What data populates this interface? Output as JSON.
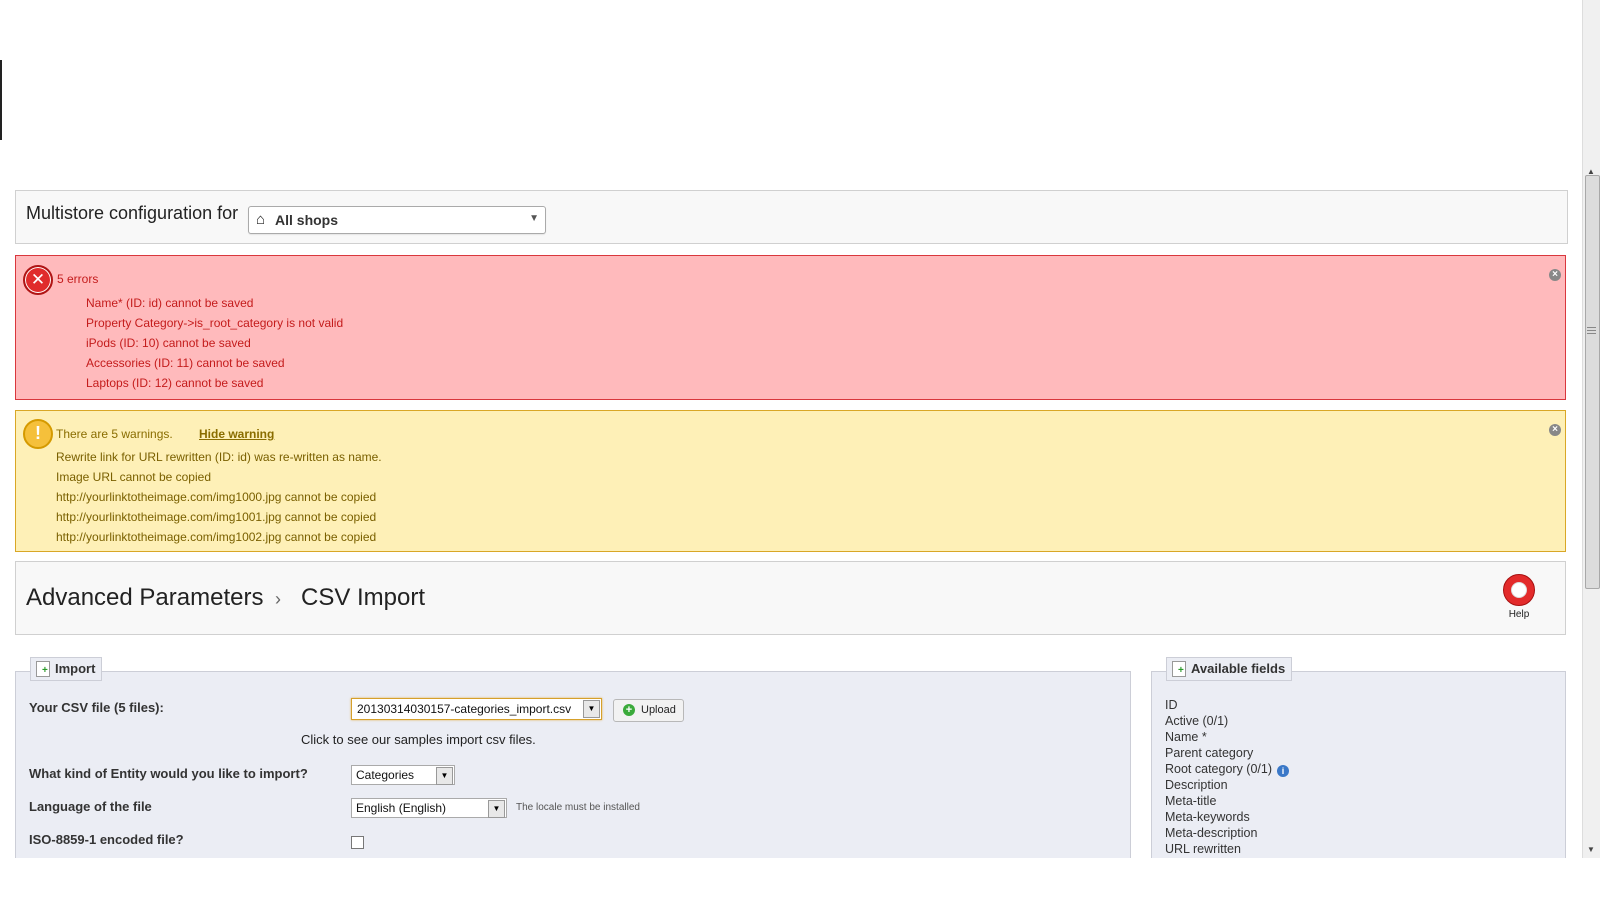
{
  "multistore": {
    "label": "Multistore configuration for",
    "selected_shop": "All shops"
  },
  "errors": {
    "title": "5 errors",
    "items": [
      "Name* (ID: id) cannot be saved",
      "Property Category->is_root_category is not valid",
      "iPods (ID: 10) cannot be saved",
      "Accessories (ID: 11) cannot be saved",
      "Laptops (ID: 12) cannot be saved"
    ]
  },
  "warnings": {
    "title": "There are 5 warnings.",
    "toggle_label": "Hide warning",
    "items": [
      "Rewrite link for URL rewritten (ID: id) was re-written as name.",
      "Image URL cannot be copied",
      "http://yourlinktotheimage.com/img1000.jpg cannot be copied",
      "http://yourlinktotheimage.com/img1001.jpg cannot be copied",
      "http://yourlinktotheimage.com/img1002.jpg cannot be copied"
    ]
  },
  "breadcrumb": {
    "parent": "Advanced Parameters",
    "separator": "›",
    "current": "CSV Import"
  },
  "help": {
    "label": "Help"
  },
  "import": {
    "legend": "Import",
    "csv_label": "Your CSV file (5 files):",
    "csv_selected": "20130314030157-categories_import.csv",
    "upload_label": "Upload",
    "samples_text": "Click to see our samples import csv files.",
    "entity_label": "What kind of Entity would you like to import?",
    "entity_selected": "Categories",
    "language_label": "Language of the file",
    "language_selected": "English (English)",
    "locale_note": "The locale must be installed",
    "iso_label": "ISO-8859-1 encoded file?"
  },
  "available_fields": {
    "legend": "Available fields",
    "items": [
      "ID",
      "Active (0/1)",
      "Name *",
      "Parent category",
      "Root category (0/1)",
      "Description",
      "Meta-title",
      "Meta-keywords",
      "Meta-description",
      "URL rewritten"
    ]
  },
  "colors": {
    "error_bg": "#ffbabc",
    "error_border": "#d9373d",
    "warning_bg": "#fef0b7",
    "warning_border": "#d9a726",
    "panel_bg": "#ebedf4"
  }
}
